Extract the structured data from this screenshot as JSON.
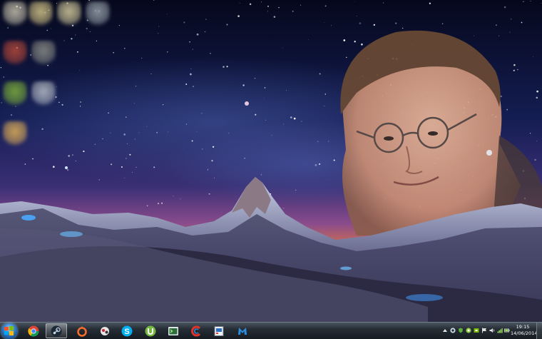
{
  "desktop": {
    "icons": [
      {
        "name": "desktop-icon-1",
        "color": "#c9c4b0"
      },
      {
        "name": "desktop-icon-2",
        "color": "#d8c98a"
      },
      {
        "name": "desktop-icon-3",
        "color": "#d9d0a0"
      },
      {
        "name": "desktop-icon-4",
        "color": "#9aa4ad"
      },
      {
        "name": "desktop-icon-5",
        "color": "#b84a3a"
      },
      {
        "name": "desktop-icon-6",
        "color": "#8d8f88"
      },
      {
        "name": "desktop-icon-7",
        "color": "#7fb23a"
      },
      {
        "name": "desktop-icon-8",
        "color": "#b9c0c8"
      },
      {
        "name": "desktop-icon-9",
        "color": "#e3b256"
      }
    ]
  },
  "taskbar": {
    "start_icon": "windows-start-orb",
    "pinned": [
      {
        "name": "chrome",
        "icon": "chrome-icon",
        "active": false
      },
      {
        "name": "steam",
        "icon": "steam-icon",
        "active": true
      },
      {
        "name": "origin",
        "icon": "origin-icon",
        "active": false
      },
      {
        "name": "game-app",
        "icon": "game-icon",
        "active": false
      },
      {
        "name": "skype",
        "icon": "skype-icon",
        "active": false
      },
      {
        "name": "utorrent",
        "icon": "utorrent-icon",
        "active": false
      },
      {
        "name": "terminal",
        "icon": "terminal-icon",
        "active": false
      },
      {
        "name": "ccleaner",
        "icon": "ccleaner-icon",
        "active": false
      },
      {
        "name": "paint",
        "icon": "paint-icon",
        "active": false
      },
      {
        "name": "malwarebytes",
        "icon": "malwarebytes-icon",
        "active": false
      }
    ],
    "tray_icons": [
      "steam-tray-icon",
      "shield-tray-icon",
      "network-tray-icon",
      "nvidia-tray-icon",
      "flag-tray-icon",
      "volume-tray-icon",
      "battery-tray-icon",
      "signal-tray-icon"
    ],
    "clock": {
      "time": "19:15",
      "date": "14/06/2014"
    }
  },
  "colors": {
    "taskbar_top": "#4a5560",
    "taskbar_bottom": "#161b21",
    "accent": "#2f7fd0"
  }
}
